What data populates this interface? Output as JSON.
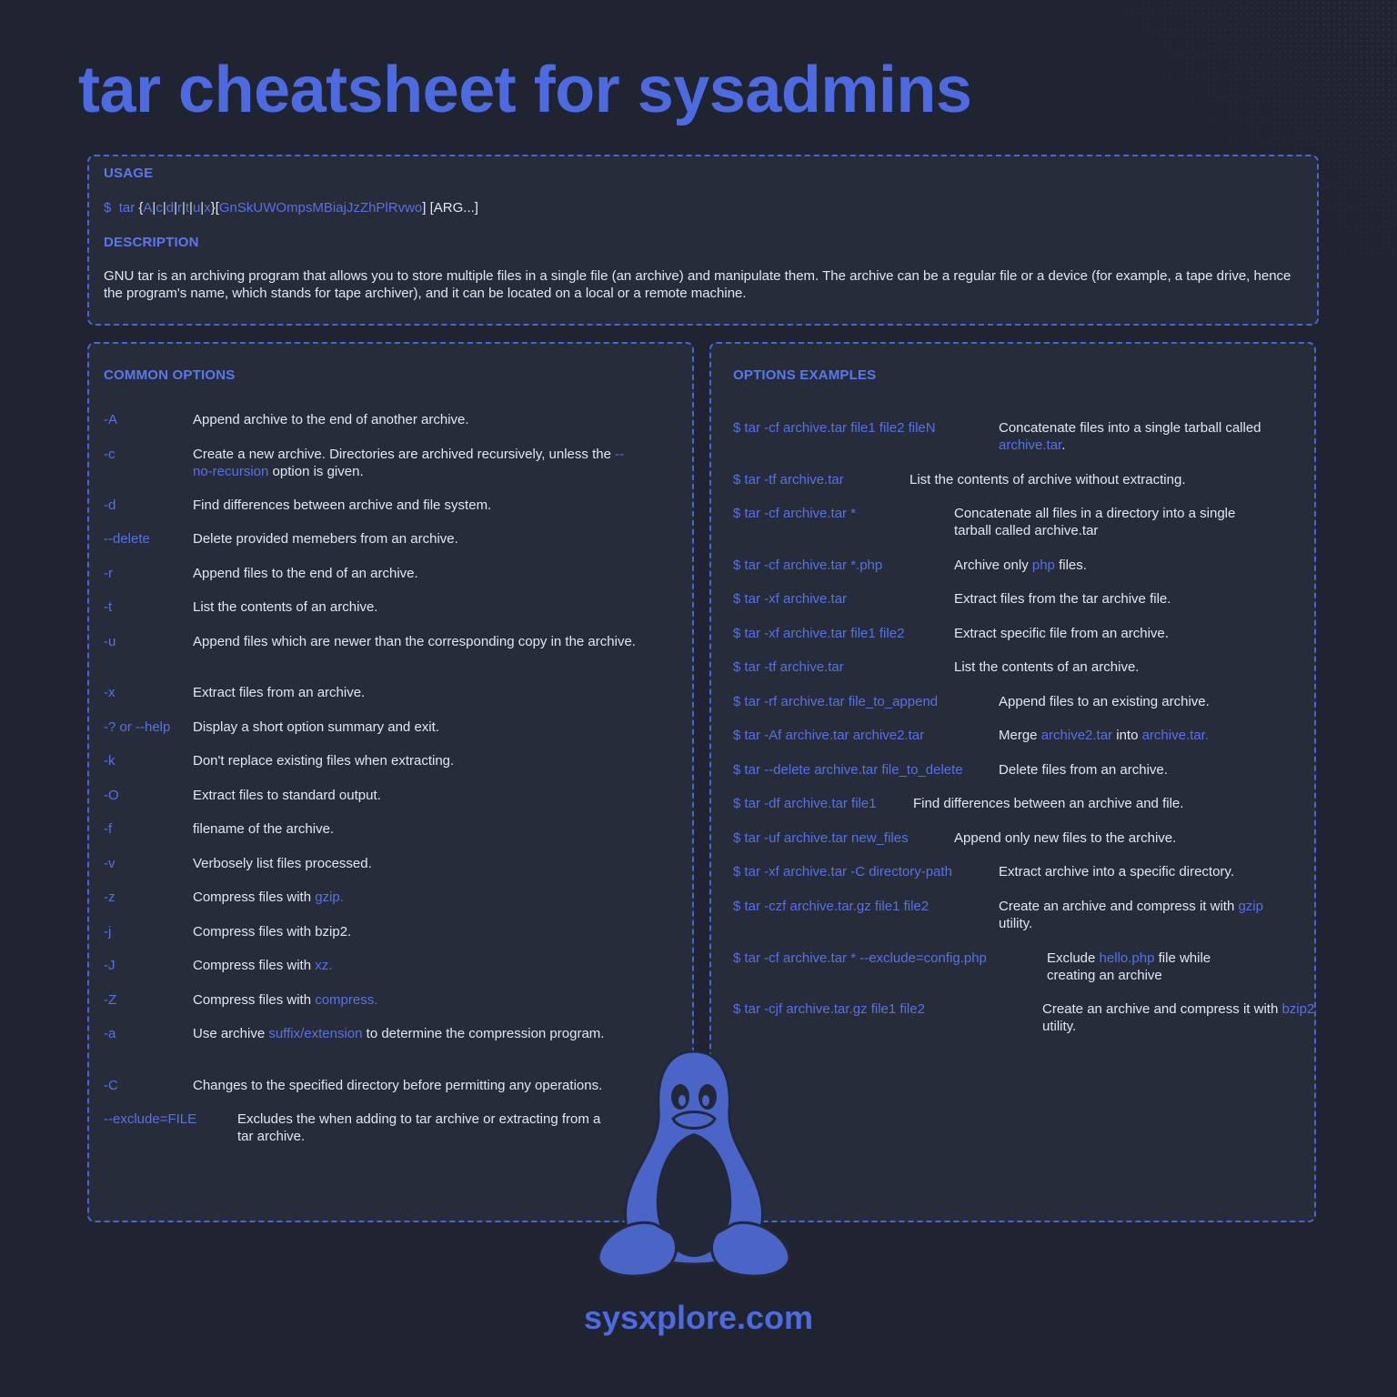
{
  "title": "tar cheatsheet for sysadmins",
  "usage": {
    "heading": "USAGE",
    "prompt": "$",
    "command": "tar",
    "open_brace": "{",
    "modes": [
      "A",
      "c",
      "d",
      "r",
      "t",
      "u",
      "x"
    ],
    "close_brace": "}",
    "opt_open": "[",
    "flags": "GnSkUWOmpsMBiajJzZhPlRvwo",
    "opt_close": "]",
    "args": "[ARG...]"
  },
  "description": {
    "heading": "DESCRIPTION",
    "text": "GNU tar is an archiving program that allows you to store multiple files in a single file (an archive) and manipulate them.  The archive can be a regular file or a device (for example, a tape drive, hence the program's name, which stands for tape archiver), and it can be located on a local or a remote machine."
  },
  "common_options": {
    "heading": "COMMON OPTIONS",
    "items": [
      {
        "flag": "-A",
        "pre": "Append archive to the end of another archive."
      },
      {
        "flag": "-c",
        "pre": "Create a new archive. Directories are archived recursively, unless the ",
        "hl": "--no-recursion",
        "post": " option is given."
      },
      {
        "flag": "-d",
        "pre": "Find differences between archive and file system."
      },
      {
        "flag": "--delete",
        "pre": "Delete provided memebers from an archive."
      },
      {
        "flag": "-r",
        "pre": "Append files to the end of an archive."
      },
      {
        "flag": "-t",
        "pre": "List the contents of an archive."
      },
      {
        "flag": "-u",
        "pre": "Append  files  which are newer than the corresponding copy in the archive."
      },
      {
        "flag": "-x",
        "pre": "Extract files from an archive."
      },
      {
        "flag": "-? or --help",
        "pre": "Display a short option summary and exit."
      },
      {
        "flag": "-k",
        "pre": "Don't replace existing files when extracting."
      },
      {
        "flag": "-O",
        "pre": "Extract files to standard output."
      },
      {
        "flag": "-f",
        "pre": "filename of the archive."
      },
      {
        "flag": "-v",
        "pre": "Verbosely list files processed."
      },
      {
        "flag": "-z",
        "pre": "Compress files with ",
        "hl": "gzip."
      },
      {
        "flag": "-j",
        "pre": "Compress files with bzip2."
      },
      {
        "flag": "-J",
        "pre": "Compress files with ",
        "hl": "xz."
      },
      {
        "flag": "-Z",
        "pre": "Compress files with ",
        "hl": "compress."
      },
      {
        "flag": "-a",
        "pre": "Use archive ",
        "hl": "suffix/extension",
        "post": " to determine the compression program."
      },
      {
        "flag": "-C",
        "pre": "Changes to the specified directory before permitting any operations."
      },
      {
        "flag": "--exclude=FILE",
        "pre": "Excludes the when adding to tar archive or extracting from a tar archive."
      }
    ]
  },
  "options_examples": {
    "heading": "OPTIONS EXAMPLES",
    "items": [
      {
        "cmd": "$ tar -cf archive.tar file1 file2 fileN",
        "pre": "Concatenate files into a single tarball called ",
        "hl": "archive.tar",
        "post": "."
      },
      {
        "cmd": "$ tar -tf archive.tar",
        "pre": "List the contents of archive without extracting."
      },
      {
        "cmd": "$ tar -cf archive.tar *",
        "pre": "Concatenate all files in a directory into a single tarball  called archive.tar"
      },
      {
        "cmd": "$ tar -cf archive.tar *.php",
        "pre": "Archive only ",
        "hl": "php",
        "post": " files."
      },
      {
        "cmd": "$ tar -xf archive.tar",
        "pre": "Extract files from the tar archive file."
      },
      {
        "cmd": "$ tar -xf archive.tar file1 file2",
        "pre": "Extract specific file from an archive."
      },
      {
        "cmd": "$ tar -tf archive.tar",
        "pre": "List the contents of an archive."
      },
      {
        "cmd": "$ tar -rf archive.tar file_to_append",
        "pre": "Append files to an existing archive."
      },
      {
        "cmd": "$ tar -Af archive.tar archive2.tar",
        "pre": "Merge ",
        "hl": "archive2.tar",
        "post": " into ",
        "hl2": "archive.tar."
      },
      {
        "cmd": "$ tar --delete archive.tar file_to_delete",
        "pre": "Delete files from an archive."
      },
      {
        "cmd": "$ tar -df archive.tar file1",
        "pre": "Find differences between an archive and file."
      },
      {
        "cmd": "$ tar -uf archive.tar new_files",
        "pre": "Append only new files to the archive."
      },
      {
        "cmd": "$ tar -xf archive.tar -C directory-path",
        "pre": "Extract archive into a specific directory."
      },
      {
        "cmd": "$ tar -czf archive.tar.gz  file1 file2",
        "pre": "Create an archive and compress it with ",
        "hl": "gzip",
        "post": " utility."
      },
      {
        "cmd": "$ tar -cf archive.tar *  --exclude=config.php",
        "pre": "Exclude ",
        "hl": "hello.php",
        "post": " file while creating an archive"
      },
      {
        "cmd": "$ tar -cjf archive.tar.gz  file1 file2",
        "pre": "Create an archive and compress it with ",
        "hl": "bzip2",
        "post": " utility."
      }
    ]
  },
  "colors": {
    "background": "#202431",
    "panel": "#272c3b",
    "accent": "#5671e4",
    "text": "#e3e6ee"
  },
  "mascot": "penguin-icon",
  "footer": "sysxplore.com"
}
